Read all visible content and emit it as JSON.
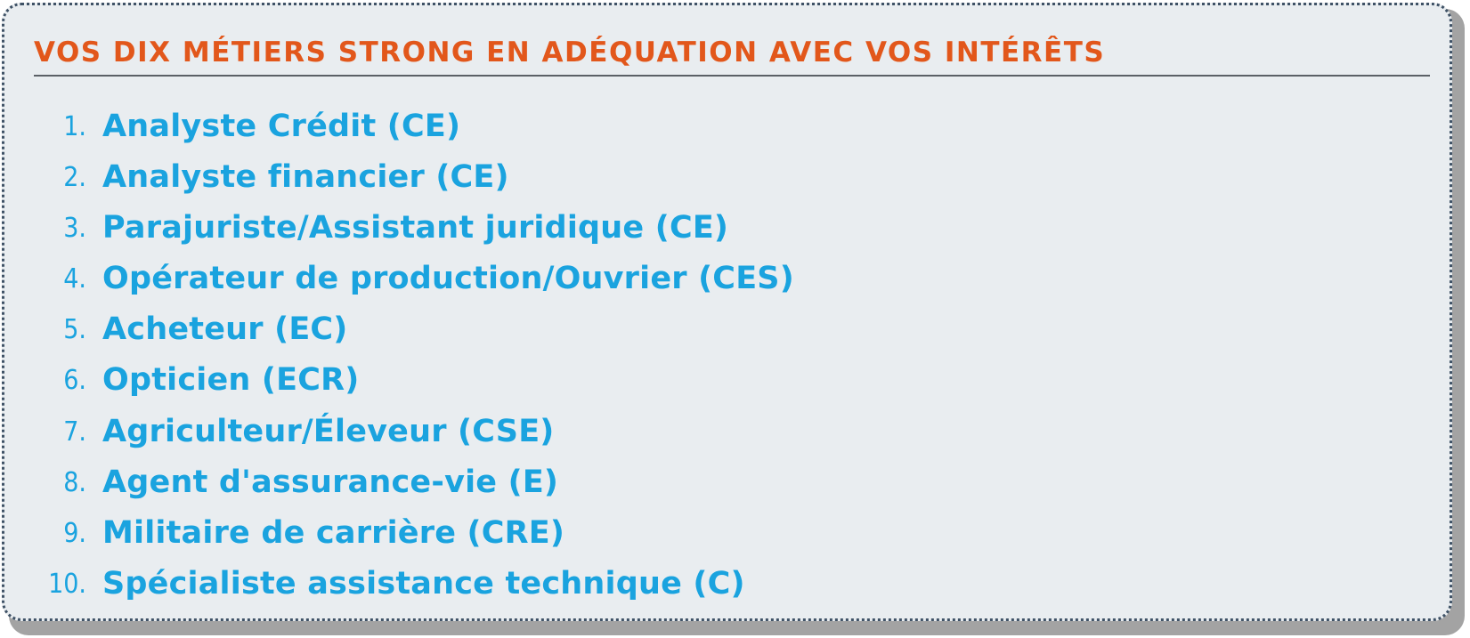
{
  "header": {
    "title": "VOS DIX MÉTIERS STRONG EN ADÉQUATION AVEC VOS INTÉRÊTS"
  },
  "colors": {
    "title": "#e2571b",
    "list_text": "#1aa3df",
    "card_background": "#e9edf0",
    "card_border": "#3f5266",
    "shadow": "#a3a3a3"
  },
  "jobs": [
    {
      "number": "1.",
      "label": "Analyste Crédit (CE)"
    },
    {
      "number": "2.",
      "label": "Analyste financier (CE)"
    },
    {
      "number": "3.",
      "label": "Parajuriste/Assistant juridique (CE)"
    },
    {
      "number": "4.",
      "label": "Opérateur de production/Ouvrier (CES)"
    },
    {
      "number": "5.",
      "label": "Acheteur (EC)"
    },
    {
      "number": "6.",
      "label": "Opticien (ECR)"
    },
    {
      "number": "7.",
      "label": "Agriculteur/Éleveur  (CSE)"
    },
    {
      "number": "8.",
      "label": "Agent d'assurance-vie (E)"
    },
    {
      "number": "9.",
      "label": "Militaire de carrière (CRE)"
    },
    {
      "number": "10.",
      "label": "Spécialiste assistance technique (C)"
    }
  ]
}
